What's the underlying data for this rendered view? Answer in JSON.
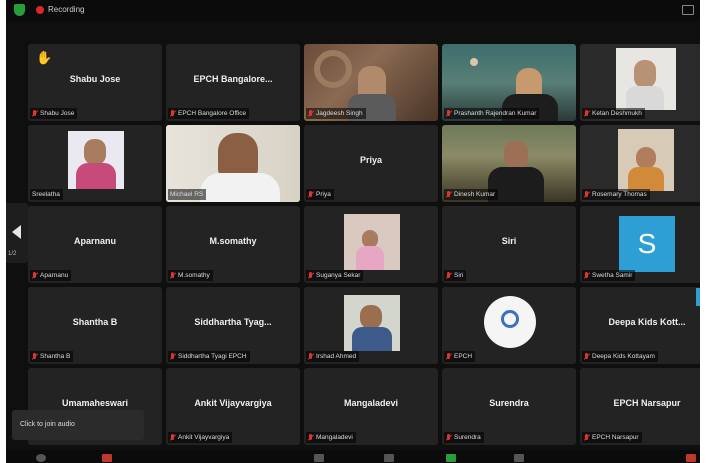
{
  "topbar": {
    "recording_label": "Recording"
  },
  "nav": {
    "page_indicator": "1/2"
  },
  "tiles": [
    {
      "name": "Shabu Jose",
      "label": "Shabu Jose",
      "kind": "name"
    },
    {
      "name": "EPCH  Bangalore...",
      "label": "EPCH Bangalore Office",
      "kind": "name"
    },
    {
      "name": "",
      "label": "Jagdeesh Singh",
      "kind": "video"
    },
    {
      "name": "",
      "label": "Prashanth Rajendran Kumar",
      "kind": "video"
    },
    {
      "name": "",
      "label": "Ketan Deshmukh",
      "kind": "video"
    },
    {
      "name": "",
      "label": "Sreelatha",
      "kind": "video"
    },
    {
      "name": "",
      "label": "Michael RS",
      "kind": "video"
    },
    {
      "name": "Priya",
      "label": "Priya",
      "kind": "name"
    },
    {
      "name": "",
      "label": "Dinesh Kumar",
      "kind": "video"
    },
    {
      "name": "",
      "label": "Rosemary Thomas",
      "kind": "video"
    },
    {
      "name": "Aparnanu",
      "label": "Aparnanu",
      "kind": "name"
    },
    {
      "name": "M.somathy",
      "label": "M.somathy",
      "kind": "name"
    },
    {
      "name": "",
      "label": "Suganya Sekar",
      "kind": "video"
    },
    {
      "name": "Siri",
      "label": "Siri",
      "kind": "name"
    },
    {
      "name": "",
      "label": "Swetha Samir",
      "kind": "avatar",
      "avatar_letter": "S"
    },
    {
      "name": "Shantha B",
      "label": "Shantha B",
      "kind": "name"
    },
    {
      "name": "Siddhartha  Tyag...",
      "label": "Siddhartha Tyagi EPCH",
      "kind": "name"
    },
    {
      "name": "",
      "label": "Irshad Ahmed",
      "kind": "video"
    },
    {
      "name": "",
      "label": "EPCH",
      "kind": "logo"
    },
    {
      "name": "Deepa Kids Kott...",
      "label": "Deepa Kids Kottayam",
      "kind": "name"
    },
    {
      "name": "Umamaheswari",
      "label": "",
      "kind": "name"
    },
    {
      "name": "Ankit Vijayvargiya",
      "label": "Ankit Vijayvargiya",
      "kind": "name"
    },
    {
      "name": "Mangaladevi",
      "label": "Mangaladevi",
      "kind": "name"
    },
    {
      "name": "Surendra",
      "label": "Surendra",
      "kind": "name"
    },
    {
      "name": "EPCH Narsapur",
      "label": "EPCH Narsapur",
      "kind": "name"
    }
  ],
  "join_audio": {
    "label": "Click to join audio"
  },
  "colors": {
    "tile_bg": "#232323",
    "active_speaker": "#d9e070",
    "mute_red": "#e03333",
    "avatar_blue": "#2d9fd4"
  }
}
